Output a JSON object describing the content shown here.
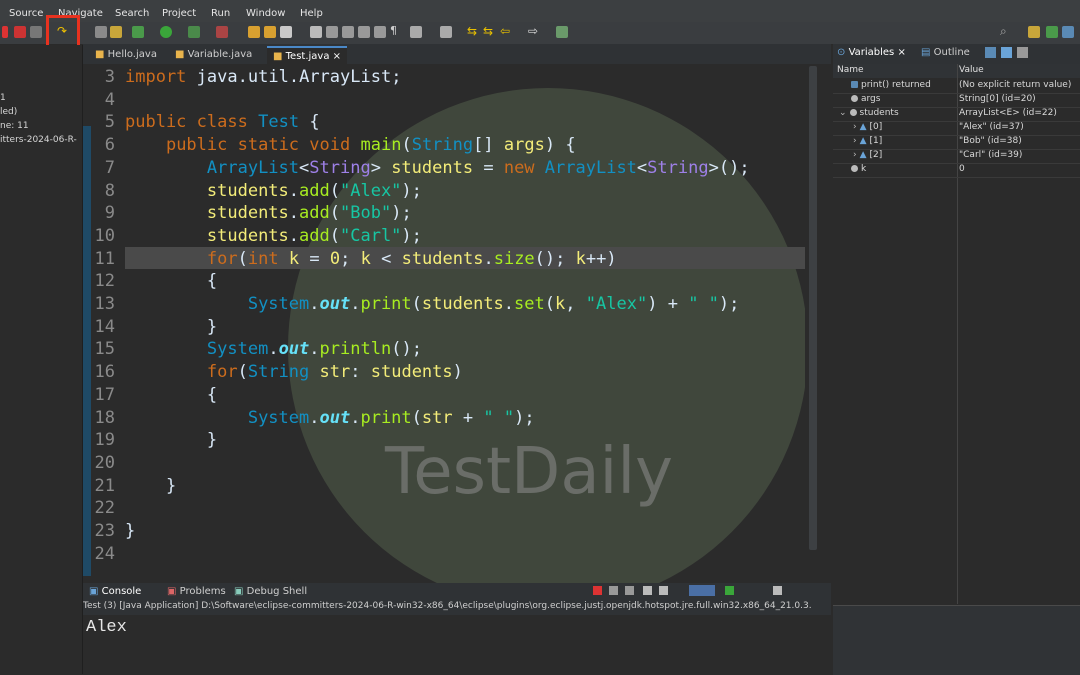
{
  "menu": [
    "Source",
    "Navigate",
    "Search",
    "Project",
    "Run",
    "Window",
    "Help"
  ],
  "editor_tabs": [
    {
      "label": "Hello.java"
    },
    {
      "label": "Variable.java"
    },
    {
      "label": "Test.java",
      "close": "×"
    }
  ],
  "left_panel_lines": [
    "1",
    "led)",
    "ne: 11",
    "itters-2024-06-R-"
  ],
  "code_lines": [
    {
      "num": "3",
      "text": "import java.util.ArrayList;"
    },
    {
      "num": "4",
      "text": ""
    },
    {
      "num": "5",
      "text": "public class Test {"
    },
    {
      "num": "6",
      "text": "    public static void main(String[] args) {"
    },
    {
      "num": "7",
      "text": "        ArrayList<String> students = new ArrayList<String>();"
    },
    {
      "num": "8",
      "text": "        students.add(\"Alex\");"
    },
    {
      "num": "9",
      "text": "        students.add(\"Bob\");"
    },
    {
      "num": "10",
      "text": "        students.add(\"Carl\");"
    },
    {
      "num": "11",
      "text": "        for(int k = 0; k < students.size(); k++)"
    },
    {
      "num": "12",
      "text": "        {"
    },
    {
      "num": "13",
      "text": "            System.out.print(students.set(k, \"Alex\") + \" \");"
    },
    {
      "num": "14",
      "text": "        }"
    },
    {
      "num": "15",
      "text": "        System.out.println();"
    },
    {
      "num": "16",
      "text": "        for(String str: students)"
    },
    {
      "num": "17",
      "text": "        {"
    },
    {
      "num": "18",
      "text": "            System.out.print(str + \" \");"
    },
    {
      "num": "19",
      "text": "        }"
    },
    {
      "num": "20",
      "text": ""
    },
    {
      "num": "21",
      "text": "    }"
    },
    {
      "num": "22",
      "text": ""
    },
    {
      "num": "23",
      "text": "}"
    },
    {
      "num": "24",
      "text": ""
    }
  ],
  "watermark_text": "TestDaily",
  "console": {
    "tabs": [
      "Console",
      "Problems",
      "Debug Shell"
    ],
    "path": "Test (3) [Java Application] D:\\Software\\eclipse-committers-2024-06-R-win32-x86_64\\eclipse\\plugins\\org.eclipse.justj.openjdk.hotspot.jre.full.win32.x86_64_21.0.3.",
    "output": "Alex"
  },
  "variables": {
    "tabs": [
      "Variables",
      "Outline"
    ],
    "col_name": "Name",
    "col_value": "Value",
    "rows": [
      {
        "name": "print() returned",
        "value": "(No explicit return value)"
      },
      {
        "name": "args",
        "value": "String[0]  (id=20)"
      },
      {
        "name": "students",
        "value": "ArrayList<E>  (id=22)"
      },
      {
        "name": "[0]",
        "value": "\"Alex\" (id=37)"
      },
      {
        "name": "[1]",
        "value": "\"Bob\" (id=38)"
      },
      {
        "name": "[2]",
        "value": "\"Carl\" (id=39)"
      },
      {
        "name": "k",
        "value": "0"
      }
    ]
  }
}
